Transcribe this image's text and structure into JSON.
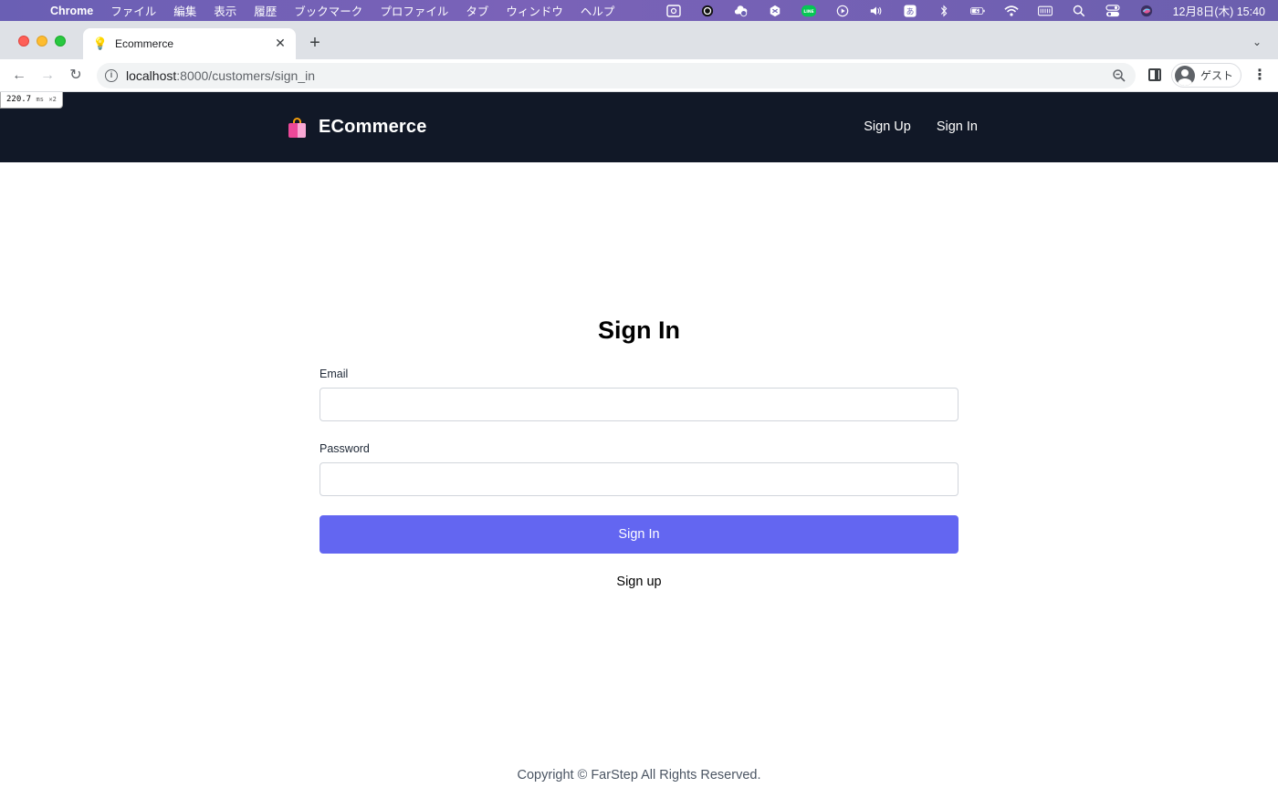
{
  "menubar": {
    "apple_glyph": "",
    "items": [
      "Chrome",
      "ファイル",
      "編集",
      "表示",
      "履歴",
      "ブックマーク",
      "プロファイル",
      "タブ",
      "ウィンドウ",
      "ヘルプ"
    ],
    "status_icons": [
      "screen-share-icon",
      "target-icon",
      "cloud-sync-icon",
      "dropbox-icon",
      "line-icon",
      "play-icon",
      "volume-icon",
      "input-method-icon",
      "bluetooth-icon",
      "battery-icon",
      "wifi-icon",
      "keyboard-icon",
      "spotlight-icon",
      "control-center-icon",
      "siri-icon"
    ],
    "input_method_label": "あ",
    "line_label": "LINE",
    "clock": "12月8日(木) 15:40"
  },
  "browser": {
    "tab_title": "Ecommerce",
    "favicon_glyph": "💡",
    "close_glyph": "✕",
    "newtab_glyph": "+",
    "tabsearch_glyph": "⌄",
    "back_glyph": "←",
    "forward_glyph": "→",
    "reload_glyph": "↻",
    "info_glyph": "i",
    "url_host": "localhost",
    "url_path": ":8000/customers/sign_in",
    "profile_name": "ゲスト",
    "menu_glyph": "⋮"
  },
  "timer": {
    "value": "220.7",
    "unit": "ms",
    "multiplier": "✕2"
  },
  "header": {
    "brand": "ECommerce",
    "nav": {
      "sign_up": "Sign Up",
      "sign_in": "Sign In"
    }
  },
  "form": {
    "title": "Sign In",
    "email_label": "Email",
    "email_value": "",
    "password_label": "Password",
    "password_value": "",
    "submit_label": "Sign In",
    "signup_link": "Sign up"
  },
  "footer": {
    "copyright": "Copyright © FarStep All Rights Reserved."
  },
  "colors": {
    "header_bg": "#111827",
    "primary_button": "#6366f1",
    "footer_text": "#4b5563"
  }
}
